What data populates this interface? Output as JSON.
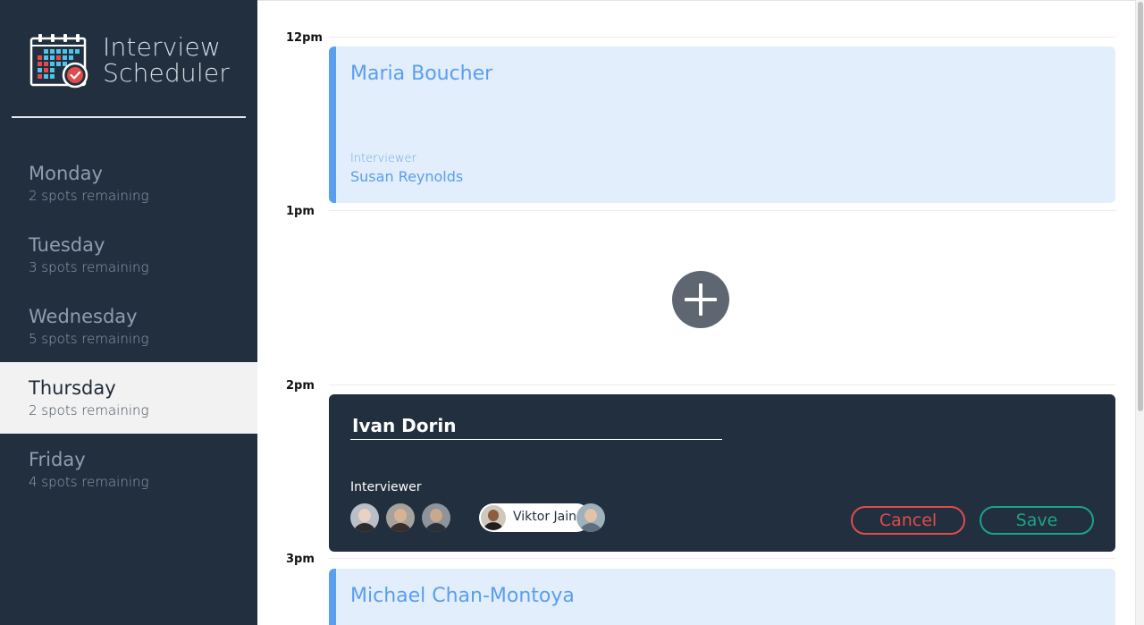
{
  "brand": {
    "line1": "Interview",
    "line2": "Scheduler",
    "logo_icon": "calendar-check-icon"
  },
  "days": [
    {
      "name": "Monday",
      "spots": "2 spots remaining",
      "selected": false
    },
    {
      "name": "Tuesday",
      "spots": "3 spots remaining",
      "selected": false
    },
    {
      "name": "Wednesday",
      "spots": "5 spots remaining",
      "selected": false
    },
    {
      "name": "Thursday",
      "spots": "2 spots remaining",
      "selected": true
    },
    {
      "name": "Friday",
      "spots": "4 spots remaining",
      "selected": false
    }
  ],
  "schedule": {
    "times": [
      "12pm",
      "1pm",
      "2pm",
      "3pm"
    ],
    "appointments": [
      {
        "student": "Maria Boucher",
        "interviewer_label": "Interviewer",
        "interviewer": "Susan Reynolds"
      },
      {
        "student": "Michael Chan-Montoya"
      }
    ],
    "add_icon": "plus-icon",
    "form": {
      "student_value": "Ivan Dorin",
      "interviewer_label": "Interviewer",
      "selected_interviewer": "Viktor Jain",
      "cancel_label": "Cancel",
      "save_label": "Save"
    }
  },
  "colors": {
    "sidebar": "#222f3e",
    "accent_blue": "#5a9eee",
    "appointment_bg": "#e2eefc",
    "cancel": "#e04c4c",
    "save": "#1aa583"
  }
}
